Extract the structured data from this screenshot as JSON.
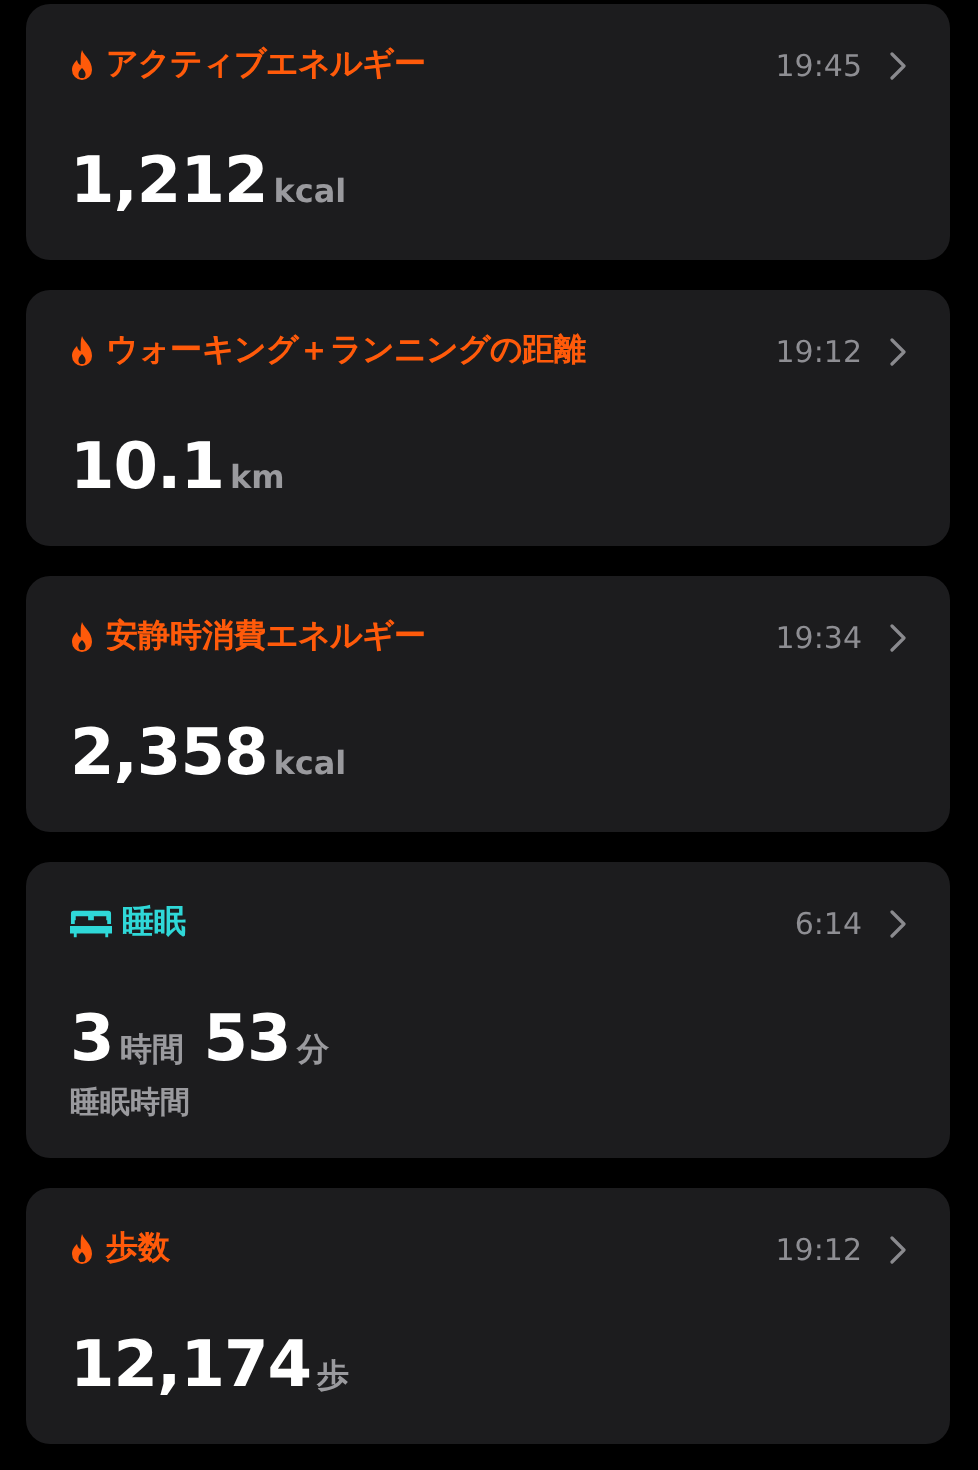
{
  "cards": [
    {
      "kind": "flame",
      "color": "#ff5a0a",
      "title": "アクティブエネルギー",
      "time": "19:45",
      "values": [
        {
          "number": "1,212",
          "unit": "kcal"
        }
      ]
    },
    {
      "kind": "flame",
      "color": "#ff5a0a",
      "title": "ウォーキング＋ランニングの距離",
      "time": "19:12",
      "values": [
        {
          "number": "10.1",
          "unit": "km"
        }
      ]
    },
    {
      "kind": "flame",
      "color": "#ff5a0a",
      "title": "安静時消費エネルギー",
      "time": "19:34",
      "values": [
        {
          "number": "2,358",
          "unit": "kcal"
        }
      ]
    },
    {
      "kind": "bed",
      "color": "#2fd8d8",
      "title": "睡眠",
      "time": "6:14",
      "values": [
        {
          "number": "3",
          "unit": "時間"
        },
        {
          "number": "53",
          "unit": "分"
        }
      ],
      "caption": "睡眠時間"
    },
    {
      "kind": "flame",
      "color": "#ff5a0a",
      "title": "歩数",
      "time": "19:12",
      "values": [
        {
          "number": "12,174",
          "unit": "歩"
        }
      ]
    }
  ]
}
